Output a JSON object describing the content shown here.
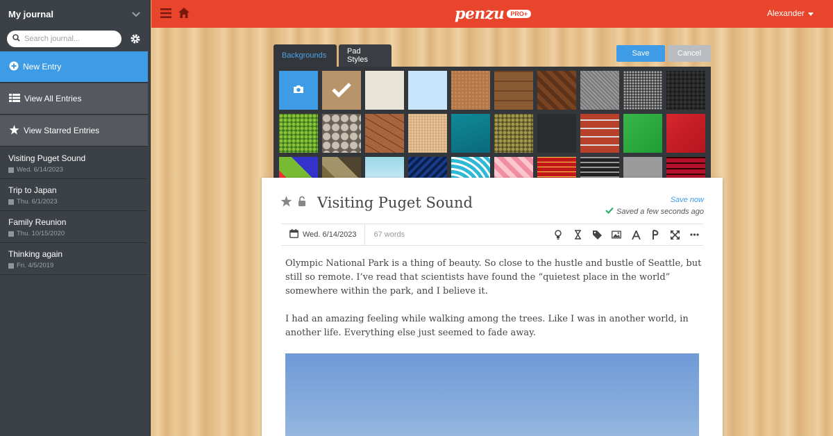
{
  "sidebar": {
    "journal_name": "My journal",
    "search_placeholder": "Search journal...",
    "nav": {
      "new_entry": "New Entry",
      "view_all": "View All Entries",
      "view_starred": "View Starred Entries"
    },
    "entries": [
      {
        "title": "Visiting Puget Sound",
        "date": "Wed. 6/14/2023"
      },
      {
        "title": "Trip to Japan",
        "date": "Thu. 6/1/2023"
      },
      {
        "title": "Family Reunion",
        "date": "Thu. 10/15/2020"
      },
      {
        "title": "Thinking again",
        "date": "Fri. 4/5/2019"
      }
    ]
  },
  "header": {
    "logo": "penzu",
    "badge": "PRO+",
    "user": "Alexander"
  },
  "customize": {
    "tabs": [
      "Backgrounds",
      "Pad Styles"
    ],
    "save": "Save",
    "cancel": "Cancel",
    "swatch_names": [
      "upload-photo",
      "wood-selected",
      "cream",
      "light-blue",
      "cork",
      "wood-planks",
      "herringbone-wood",
      "gray-fabric",
      "gravel",
      "black-leather",
      "green-grass",
      "river-stones",
      "cracked-earth",
      "sand",
      "ocean-water",
      "moss-bark",
      "dark-gray",
      "red-brick",
      "green-leaf",
      "red-leather",
      "graffiti",
      "camouflage",
      "cloud-sky",
      "blue-swirl",
      "teal-waves",
      "pink-diamond",
      "red-plaid",
      "black-plaid",
      "gray-knit",
      "red-check"
    ]
  },
  "entry": {
    "title": "Visiting Puget Sound",
    "save_now": "Save now",
    "saved_status": "Saved a few seconds ago",
    "date": "Wed. 6/14/2023",
    "word_count": "67 words",
    "paragraphs": [
      "Olympic National Park is a thing of beauty. So close to the hustle and bustle of Seattle, but still so remote. I’ve read that scientists have found the “quietest place in the world” somewhere within the park, and I believe it.",
      "I had an amazing feeling while walking among the trees. Like I was in another world, in another life. Everything else just seemed to fade away."
    ]
  },
  "colors": {
    "accent_red": "#e8452c",
    "accent_blue": "#3e9be5",
    "sidebar_bg": "#3c4147"
  }
}
